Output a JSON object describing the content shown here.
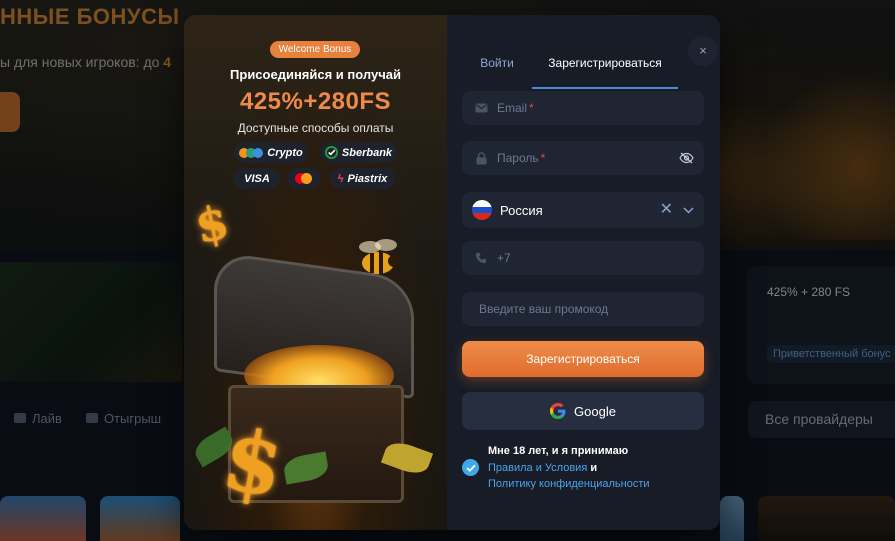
{
  "background": {
    "hero_title": "ННЫЕ БОНУСЫ",
    "hero_subtitle_prefix": "ы для новых игроков: до ",
    "hero_subtitle_highlight": "4",
    "card_right_title": "425% + 280 FS",
    "card_right_badge": "Приветственный бонус",
    "tabs": [
      {
        "label": "Лайв",
        "icon": "live-icon"
      },
      {
        "label": "Отыгрыш",
        "icon": "wager-icon"
      }
    ],
    "providers_button": "Все провайдеры"
  },
  "promo": {
    "badge": "Welcome Bonus",
    "title": "Присоединяйся и получай",
    "amount": "425%+280FS",
    "methods_label": "Доступные способы оплаты",
    "payments": [
      {
        "label": "Crypto",
        "icon": "crypto-icon"
      },
      {
        "label": "Sberbank",
        "icon": "sberbank-icon"
      },
      {
        "label": "VISA",
        "icon": "visa-icon"
      },
      {
        "label": "",
        "icon": "mastercard-icon"
      },
      {
        "label": "Piastrix",
        "icon": "piastrix-icon"
      }
    ]
  },
  "auth": {
    "close": "×",
    "tabs": {
      "login": "Войти",
      "register": "Зарегистрироваться"
    },
    "email_placeholder": "Email",
    "password_placeholder": "Пароль",
    "required_mark": "*",
    "country": "Россия",
    "phone_placeholder": "+7",
    "promo_placeholder": "Введите ваш промокод",
    "submit": "Зарегистрироваться",
    "google": "Google",
    "consent": {
      "text": "Мне 18 лет, и я принимаю",
      "terms_link": "Правила и Условия",
      "and": "и",
      "privacy_link": "Политику конфиденциальности",
      "checked": true
    }
  },
  "colors": {
    "accent_orange": "#e7813e",
    "link_blue": "#4ea3e8",
    "modal_bg": "#171c27",
    "field_bg": "#1f2533"
  }
}
